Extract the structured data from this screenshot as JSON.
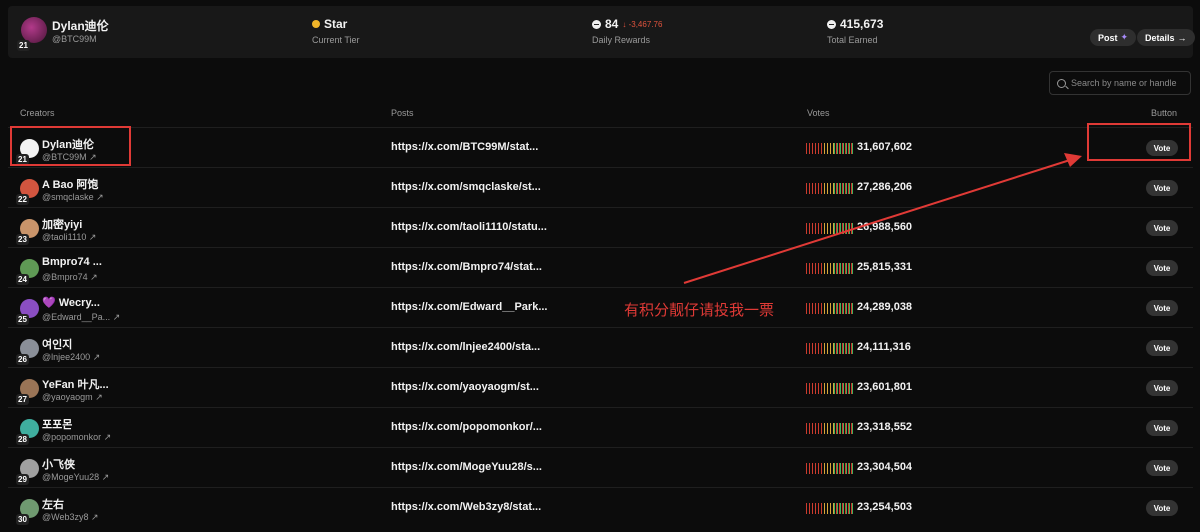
{
  "header": {
    "name": "Dylan迪伦",
    "handle": "@BTC99M",
    "level": "21",
    "tier_value": "Star",
    "tier_label": "Current Tier",
    "daily_value": "84",
    "daily_delta": "↓ -3,467.76",
    "daily_label": "Daily Rewards",
    "earned_value": "415,673",
    "earned_label": "Total Earned",
    "post_label": "Post",
    "details_label": "Details"
  },
  "search": {
    "placeholder": "Search by name or handle"
  },
  "columns": {
    "creators": "Creators",
    "posts": "Posts",
    "votes": "Votes",
    "button": "Button"
  },
  "rows": [
    {
      "rank": "21",
      "name": "Dylan迪伦",
      "handle": "@BTC99M",
      "post": "https://x.com/BTC99M/stat...",
      "votes": "31,607,602",
      "vote_label": "Vote",
      "avatar_color": "#f2f2f2"
    },
    {
      "rank": "22",
      "name": "A Bao 阿饱",
      "handle": "@smqclaske",
      "post": "https://x.com/smqclaske/st...",
      "votes": "27,286,206",
      "vote_label": "Vote",
      "avatar_color": "#d2553f"
    },
    {
      "rank": "23",
      "name": "加密yiyi",
      "handle": "@taoli1110",
      "post": "https://x.com/taoli1110/statu...",
      "votes": "26,988,560",
      "vote_label": "Vote",
      "avatar_color": "#c9946a"
    },
    {
      "rank": "24",
      "name": "Bmpro74 ...",
      "handle": "@Bmpro74",
      "post": "https://x.com/Bmpro74/stat...",
      "votes": "25,815,331",
      "vote_label": "Vote",
      "avatar_color": "#5f9a55"
    },
    {
      "rank": "25",
      "name": "💜 Wecry...",
      "handle": "@Edward__Pa...",
      "post": "https://x.com/Edward__Park...",
      "votes": "24,289,038",
      "vote_label": "Vote",
      "avatar_color": "#8a4ec2"
    },
    {
      "rank": "26",
      "name": "여인지",
      "handle": "@lnjee2400",
      "post": "https://x.com/lnjee2400/sta...",
      "votes": "24,111,316",
      "vote_label": "Vote",
      "avatar_color": "#8a8f98"
    },
    {
      "rank": "27",
      "name": "YeFan 叶凡...",
      "handle": "@yaoyaogm",
      "post": "https://x.com/yaoyaogm/st...",
      "votes": "23,601,801",
      "vote_label": "Vote",
      "avatar_color": "#9a7456"
    },
    {
      "rank": "28",
      "name": "포포몬",
      "handle": "@popomonkor",
      "post": "https://x.com/popomonkor/...",
      "votes": "23,318,552",
      "vote_label": "Vote",
      "avatar_color": "#3fae9f"
    },
    {
      "rank": "29",
      "name": "小飞侠",
      "handle": "@MogeYuu28",
      "post": "https://x.com/MogeYuu28/s...",
      "votes": "23,304,504",
      "vote_label": "Vote",
      "avatar_color": "#a0a0a0"
    },
    {
      "rank": "30",
      "name": "左右",
      "handle": "@Web3zy8",
      "post": "https://x.com/Web3zy8/stat...",
      "votes": "23,254,503",
      "vote_label": "Vote",
      "avatar_color": "#6f9a70"
    }
  ],
  "annotation": {
    "text": "有积分靓仔请投我一票",
    "color": "#e03a36"
  }
}
